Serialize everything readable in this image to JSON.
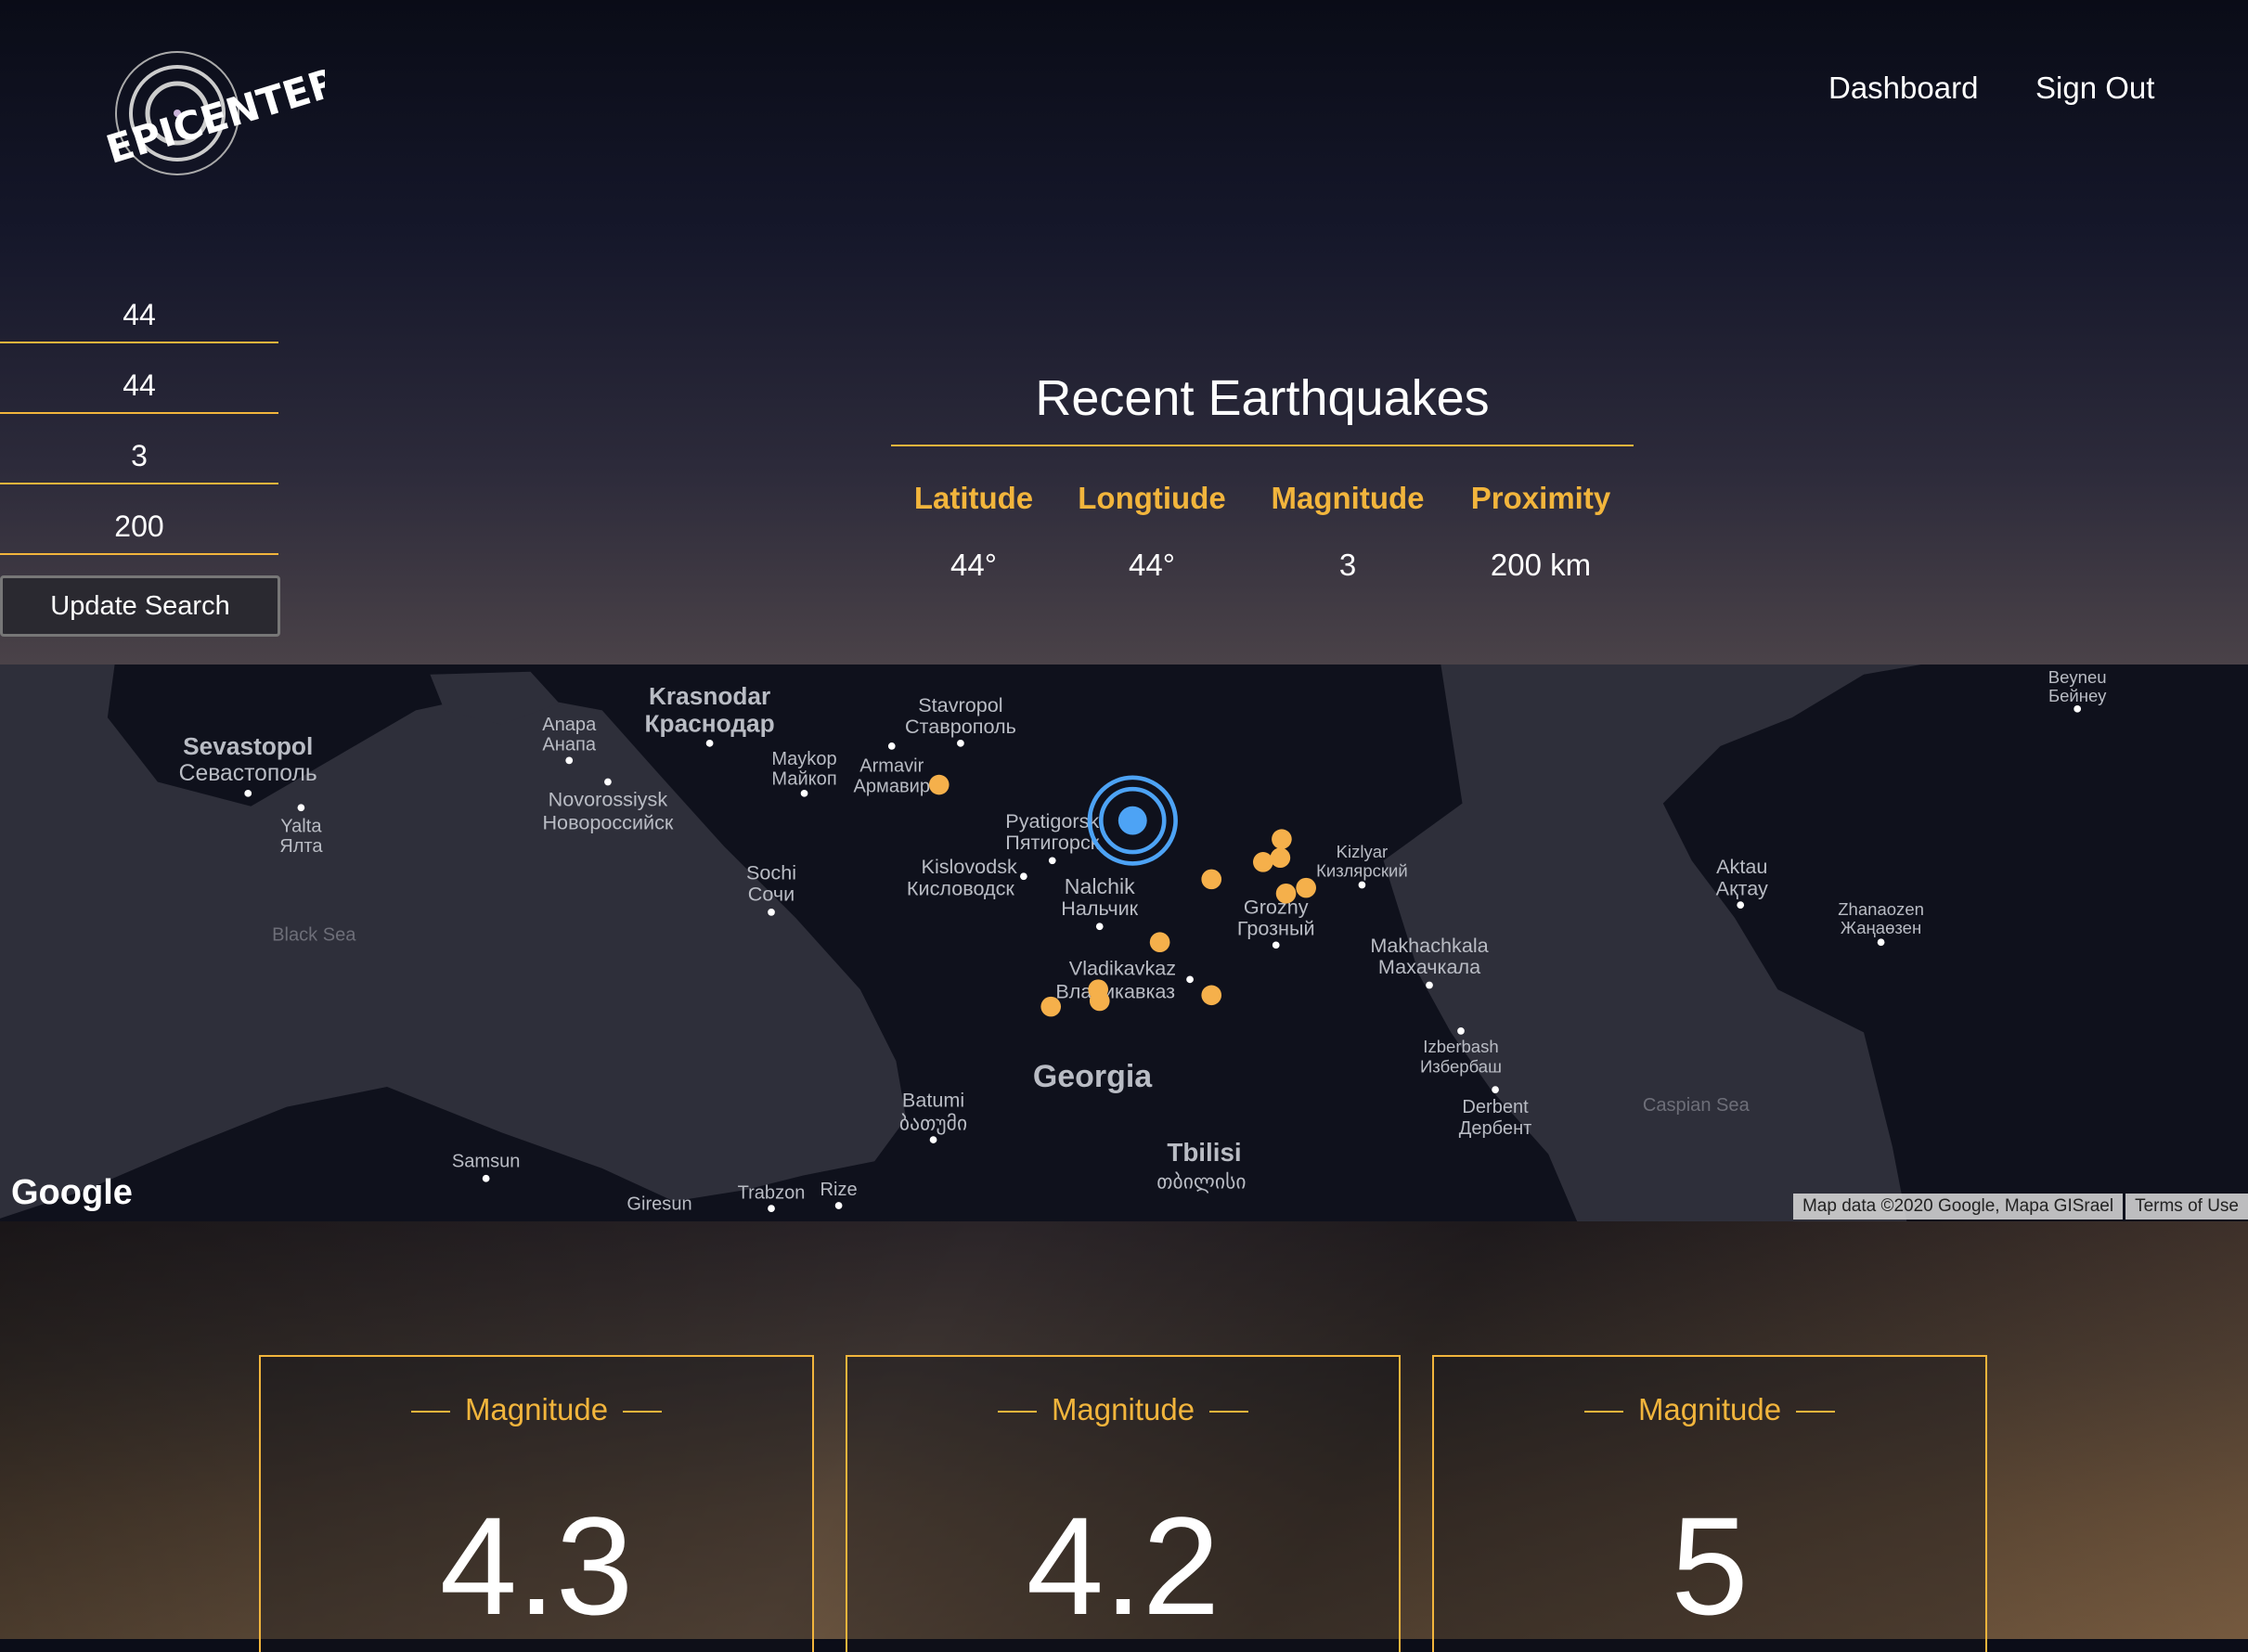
{
  "brand": {
    "logo_text": "EPICENTER"
  },
  "nav": {
    "dashboard": "Dashboard",
    "sign_out": "Sign Out"
  },
  "search": {
    "latitude": "44",
    "longitude": "44",
    "magnitude": "3",
    "proximity": "200",
    "update_label": "Update Search"
  },
  "summary": {
    "title": "Recent Earthquakes",
    "headers": [
      "Latitude",
      "Longtiude",
      "Magnitude",
      "Proximity"
    ],
    "values": [
      "44°",
      "44°",
      "3",
      "200 km"
    ]
  },
  "map": {
    "colors": {
      "land": "#0f111c",
      "water": "#2e2f3a",
      "marker": "#f5b04b",
      "center": "#4da3f5"
    },
    "labels": [
      "Krasnodar",
      "Краснодар",
      "Stavropol",
      "Ставрополь",
      "Sevastopol",
      "Севастополь",
      "Anapa",
      "Анапа",
      "Maykop",
      "Майкоп",
      "Armavir",
      "Армавир",
      "Novorossiysk",
      "Новороссийск",
      "Yalta",
      "Ялта",
      "Pyatigorsk",
      "Пятигорск",
      "Kislovodsk",
      "Кисловодск",
      "Nalchik",
      "Нальчик",
      "Kizlyar",
      "Кизлярский",
      "Grozny",
      "Грозный",
      "Sochi",
      "Сочи",
      "Makhachkala",
      "Махачкала",
      "Vladikavkaz",
      "Владикавказ",
      "Black Sea",
      "Georgia",
      "Batumi",
      "ბათუმი",
      "Izberbash",
      "Избербаш",
      "Derbent",
      "Дербент",
      "Tbilisi",
      "თბილისი",
      "Samsun",
      "Giresun",
      "Trabzon",
      "Rize",
      "Caspian Sea",
      "Aktau",
      "Ақтау",
      "Zhanaozen",
      "Жаңаөзен",
      "Beyneu",
      "Бейнеу"
    ],
    "google": "Google",
    "attribution": "Map data ©2020 Google, Mapa GISrael",
    "terms": "Terms of Use"
  },
  "cards": [
    {
      "title": "Magnitude",
      "value": "4.3"
    },
    {
      "title": "Magnitude",
      "value": "4.2"
    },
    {
      "title": "Magnitude",
      "value": "5"
    }
  ]
}
